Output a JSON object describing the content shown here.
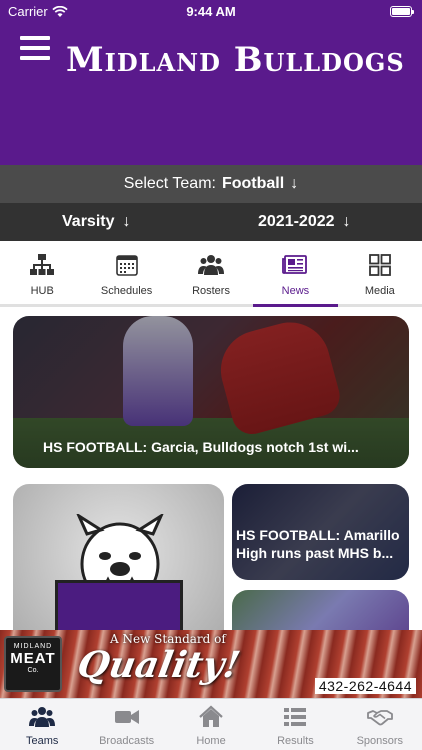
{
  "status_bar": {
    "carrier": "Carrier",
    "time": "9:44 AM"
  },
  "header": {
    "title": "Midland Bulldogs",
    "accent_color": "#5a1a8c"
  },
  "team_select": {
    "label": "Select Team:",
    "value": "Football",
    "arrow": "↓"
  },
  "level_select": {
    "level": "Varsity",
    "season": "2021-2022",
    "arrow": "↓"
  },
  "subtabs": [
    {
      "label": "HUB",
      "icon": "hub-icon",
      "active": false
    },
    {
      "label": "Schedules",
      "icon": "calendar-icon",
      "active": false
    },
    {
      "label": "Rosters",
      "icon": "people-icon",
      "active": false
    },
    {
      "label": "News",
      "icon": "newspaper-icon",
      "active": true
    },
    {
      "label": "Media",
      "icon": "grid-icon",
      "active": false
    }
  ],
  "news": [
    {
      "title": "HS FOOTBALL: Garcia, Bulldogs notch 1st wi..."
    },
    {
      "title": ""
    },
    {
      "title": "HS FOOTBALL: Amarillo High runs past MHS b..."
    },
    {
      "title": ""
    }
  ],
  "ad": {
    "logo_small": "MIDLAND",
    "logo_big": "MEAT",
    "logo_script": "Co.",
    "tagline": "A New Standard of",
    "headline": "Quality!",
    "phone": "432-262-4644"
  },
  "tabbar": [
    {
      "label": "Teams",
      "icon": "teams-icon",
      "active": true
    },
    {
      "label": "Broadcasts",
      "icon": "video-icon",
      "active": false
    },
    {
      "label": "Home",
      "icon": "home-icon",
      "active": false
    },
    {
      "label": "Results",
      "icon": "list-icon",
      "active": false
    },
    {
      "label": "Sponsors",
      "icon": "handshake-icon",
      "active": false
    }
  ]
}
